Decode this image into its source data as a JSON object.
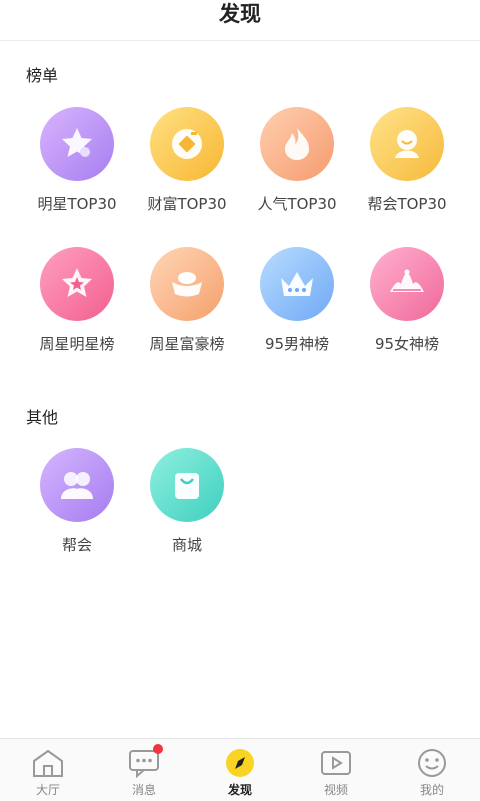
{
  "header": {
    "title": "发现"
  },
  "sections": {
    "rankings": {
      "title": "榜单",
      "items": [
        {
          "label": "明星TOP30",
          "icon": "star-icon",
          "color_from": "#d8b4fe",
          "color_to": "#a77ef0"
        },
        {
          "label": "财富TOP30",
          "icon": "coin-icon",
          "color_from": "#ffe082",
          "color_to": "#f7b733"
        },
        {
          "label": "人气TOP30",
          "icon": "flame-icon",
          "color_from": "#ffcfb0",
          "color_to": "#f59b6e"
        },
        {
          "label": "帮会TOP30",
          "icon": "group-badge-icon",
          "color_from": "#ffe38a",
          "color_to": "#f6b93b"
        },
        {
          "label": "周星明星榜",
          "icon": "weekly-star-icon",
          "color_from": "#ff9fc0",
          "color_to": "#f2608f"
        },
        {
          "label": "周星富豪榜",
          "icon": "gold-ingot-icon",
          "color_from": "#ffd6b8",
          "color_to": "#f5a06b"
        },
        {
          "label": "95男神榜",
          "icon": "crown-icon",
          "color_from": "#b8dcff",
          "color_to": "#6fa9f5"
        },
        {
          "label": "95女神榜",
          "icon": "tiara-icon",
          "color_from": "#ffb1cf",
          "color_to": "#f0689b"
        }
      ]
    },
    "other": {
      "title": "其他",
      "items": [
        {
          "label": "帮会",
          "icon": "guild-icon",
          "color_from": "#d5b6ff",
          "color_to": "#a57cf0"
        },
        {
          "label": "商城",
          "icon": "shopping-bag-icon",
          "color_from": "#8ff0e0",
          "color_to": "#3fcfbe"
        }
      ]
    }
  },
  "tabbar": {
    "items": [
      {
        "label": "大厅",
        "icon": "house-icon"
      },
      {
        "label": "消息",
        "icon": "message-icon",
        "badge": true
      },
      {
        "label": "发现",
        "icon": "compass-icon",
        "active": true
      },
      {
        "label": "视频",
        "icon": "video-icon"
      },
      {
        "label": "我的",
        "icon": "smile-icon"
      }
    ]
  },
  "colors": {
    "active_tab": "#f9d423",
    "badge": "#f2343c"
  }
}
